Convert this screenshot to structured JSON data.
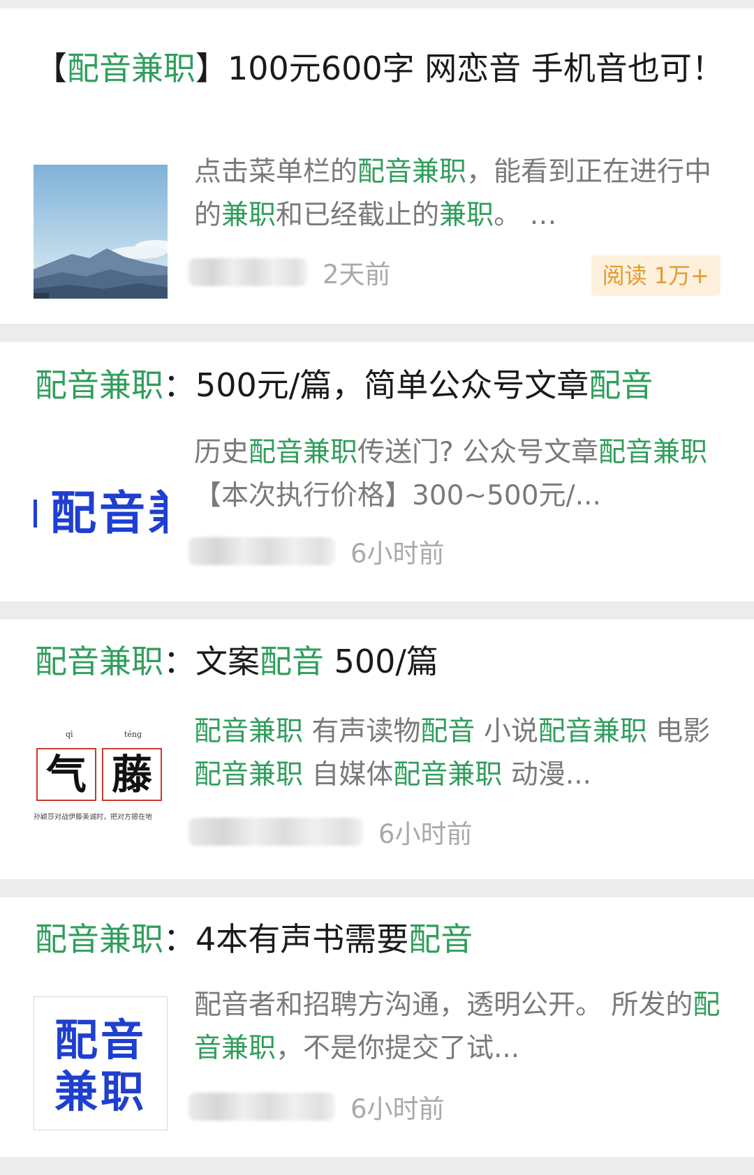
{
  "articles": [
    {
      "title_segments": [
        {
          "t": "【",
          "hl": false
        },
        {
          "t": "配音兼职",
          "hl": true
        },
        {
          "t": "】100元600字 网恋音 手机音也可！",
          "hl": false
        }
      ],
      "desc_segments": [
        {
          "t": "点击菜单栏的",
          "hl": false
        },
        {
          "t": "配音兼职",
          "hl": true
        },
        {
          "t": "，能看到正在进行中的",
          "hl": false
        },
        {
          "t": "兼职",
          "hl": true
        },
        {
          "t": "和已经截止的",
          "hl": false
        },
        {
          "t": "兼职",
          "hl": true
        },
        {
          "t": "。 …",
          "hl": false
        }
      ],
      "time": "2天前",
      "read_badge": "阅读 1万+",
      "thumb_kind": "mountain"
    },
    {
      "title_segments": [
        {
          "t": "配音兼职",
          "hl": true
        },
        {
          "t": "：500元/篇，简单公众号文章",
          "hl": false
        },
        {
          "t": "配音",
          "hl": true
        }
      ],
      "desc_segments": [
        {
          "t": "历史",
          "hl": false
        },
        {
          "t": "配音兼职",
          "hl": true
        },
        {
          "t": "传送门? 公众号文章",
          "hl": false
        },
        {
          "t": "配音兼职",
          "hl": true
        },
        {
          "t": " 【本次执行价格】300~500元/...",
          "hl": false
        }
      ],
      "time": "6小时前",
      "thumb_kind": "text-banner",
      "thumb_text": "配音兼"
    },
    {
      "title_segments": [
        {
          "t": "配音兼职",
          "hl": true
        },
        {
          "t": "：文案",
          "hl": false
        },
        {
          "t": "配音",
          "hl": true
        },
        {
          "t": " 500/篇",
          "hl": false
        }
      ],
      "desc_segments": [
        {
          "t": "配音兼职",
          "hl": true
        },
        {
          "t": " 有声读物",
          "hl": false
        },
        {
          "t": "配音",
          "hl": true
        },
        {
          "t": " 小说",
          "hl": false
        },
        {
          "t": "配音兼职",
          "hl": true
        },
        {
          "t": " 电影",
          "hl": false
        },
        {
          "t": "配音兼职",
          "hl": true
        },
        {
          "t": " 自媒体",
          "hl": false
        },
        {
          "t": "配音兼职",
          "hl": true
        },
        {
          "t": " 动漫...",
          "hl": false
        }
      ],
      "time": "6小时前",
      "thumb_kind": "calligraphy",
      "thumb_chars": [
        "气",
        "藤"
      ],
      "thumb_pinyin": [
        "qì",
        "téng"
      ],
      "thumb_caption": "孙颖莎对战伊藤美诚时，把对方摁在地"
    },
    {
      "title_segments": [
        {
          "t": "配音兼职",
          "hl": true
        },
        {
          "t": "：4本有声书需要",
          "hl": false
        },
        {
          "t": "配音",
          "hl": true
        }
      ],
      "desc_segments": [
        {
          "t": "配音者和招聘方沟通，透明公开。 所发的",
          "hl": false
        },
        {
          "t": "配音兼职",
          "hl": true
        },
        {
          "t": "，不是你提交了试...",
          "hl": false
        }
      ],
      "time": "6小时前",
      "thumb_kind": "text-square",
      "thumb_lines": [
        "配音",
        "兼职"
      ]
    }
  ],
  "colors": {
    "highlight": "#2f9e5b",
    "badge_bg": "#fdf1de",
    "badge_text": "#e69a2a",
    "thumb_blue": "#1f3fd0"
  }
}
